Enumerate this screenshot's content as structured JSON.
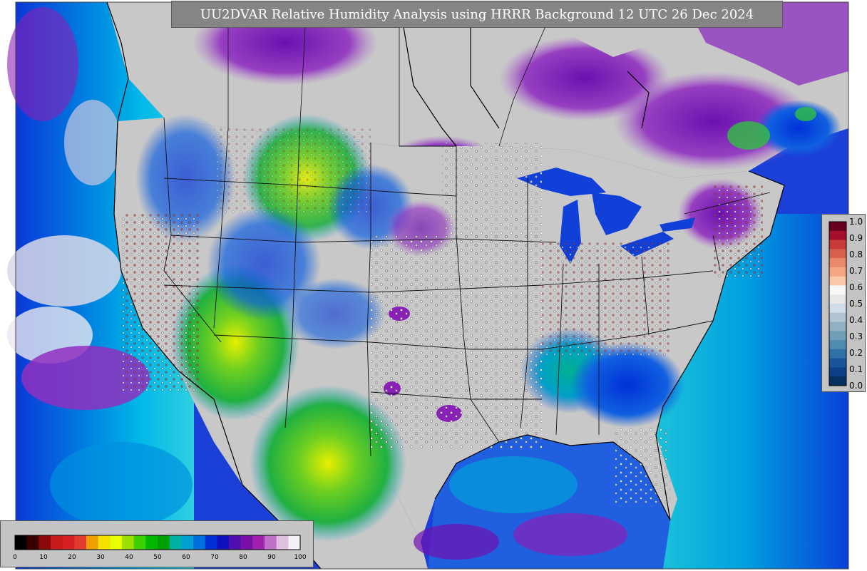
{
  "title": "UU2DVAR Relative Humidity Analysis using HRRR Background 12 UTC 26 Dec 2024",
  "legend_bottom": {
    "ticks": [
      "0",
      "10",
      "20",
      "30",
      "40",
      "50",
      "60",
      "70",
      "80",
      "90",
      "100"
    ],
    "colors": [
      "#000000",
      "#3a0000",
      "#8a0a0a",
      "#c81a1a",
      "#d42020",
      "#e33b2e",
      "#f0a000",
      "#f5e000",
      "#e8ff00",
      "#9be000",
      "#3cd000",
      "#00b800",
      "#00a000",
      "#00b0a0",
      "#00a0d0",
      "#0070e0",
      "#0030d8",
      "#1010c0",
      "#5010b0",
      "#7a10a8",
      "#a020b0",
      "#c070c8",
      "#e0c0e0",
      "#f5f0f5"
    ]
  },
  "legend_right": {
    "ticks": [
      "1.0",
      "0.9",
      "0.8",
      "0.7",
      "0.6",
      "0.5",
      "0.4",
      "0.3",
      "0.2",
      "0.1",
      "0.0"
    ],
    "colors": [
      "#67001f",
      "#a50f2e",
      "#c83a3a",
      "#d6604d",
      "#e88a6a",
      "#f4a582",
      "#f8c8a8",
      "#f7f7f7",
      "#e8e8e8",
      "#d1dde8",
      "#b0c4d4",
      "#92b0c4",
      "#6fa0b8",
      "#4f8cb0",
      "#3070a8",
      "#1a559a",
      "#0b3f86",
      "#053061"
    ]
  },
  "map": {
    "background_ocean": "#1a40d8",
    "land_neutral": "#c8c8c8",
    "humid_purple": "#8a20b8",
    "dry_green": "#30c040",
    "very_dry_yellow": "#e8f000"
  }
}
